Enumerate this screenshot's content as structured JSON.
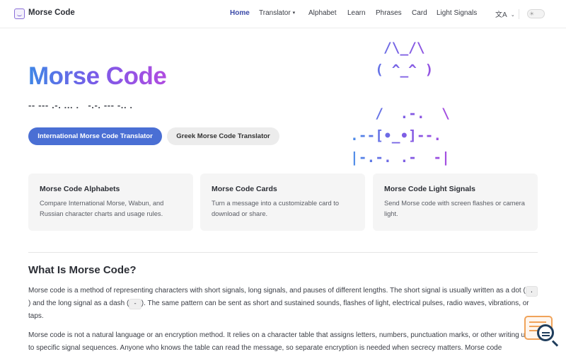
{
  "header": {
    "brand": "Morse Code",
    "nav": [
      {
        "label": "Home",
        "active": true
      },
      {
        "label": "Translator",
        "dropdown": true
      },
      {
        "label": "Alphabet"
      },
      {
        "label": "Learn"
      },
      {
        "label": "Phrases"
      },
      {
        "label": "Card"
      },
      {
        "label": "Light Signals"
      }
    ],
    "language_icon": "文A",
    "language_chevron": "⌄",
    "theme_toggle_icon": "☀"
  },
  "hero": {
    "title": "Morse Code",
    "morse": "-- --- .-. ... .   -.-. --- -.. .",
    "primary_button": "International Morse Code Translator",
    "secondary_button": "Greek Morse Code Translator",
    "ascii_art": "    /\\_/\\\n   ( ^_^ )\n\n   /  .-.  \\\n.--[•_•]--.\n|-.-. .-  -|"
  },
  "cards": [
    {
      "title": "Morse Code Alphabets",
      "desc": "Compare International Morse, Wabun, and Russian character charts and usage rules."
    },
    {
      "title": "Morse Code Cards",
      "desc": "Turn a message into a customizable card to download or share."
    },
    {
      "title": "Morse Code Light Signals",
      "desc": "Send Morse code with screen flashes or camera light."
    }
  ],
  "article": {
    "heading": "What Is Morse Code?",
    "p1_part1": "Morse code is a method of representing characters with short signals, long signals, and pauses of different lengths. The short signal is usually written as a dot (",
    "p1_code1": ".",
    "p1_part2": ") and the long signal as a dash (",
    "p1_code2": "-",
    "p1_part3": "). The same pattern can be sent as short and sustained sounds, flashes of light, electrical pulses, radio waves, vibrations, or taps.",
    "p2": "Morse code is not a natural language or an encryption method. It relies on a character table that assigns letters, numbers, punctuation marks, or other writing units to specific signal sequences. Anyone who knows the table can read the message, so separate encryption is needed when secrecy matters. Morse code"
  },
  "colors": {
    "accent": "#4a6fd4",
    "gradient_start": "#3f86e6",
    "gradient_end": "#b04ce0",
    "help_orange": "#f0a35a",
    "help_navy": "#1f3d5c"
  }
}
